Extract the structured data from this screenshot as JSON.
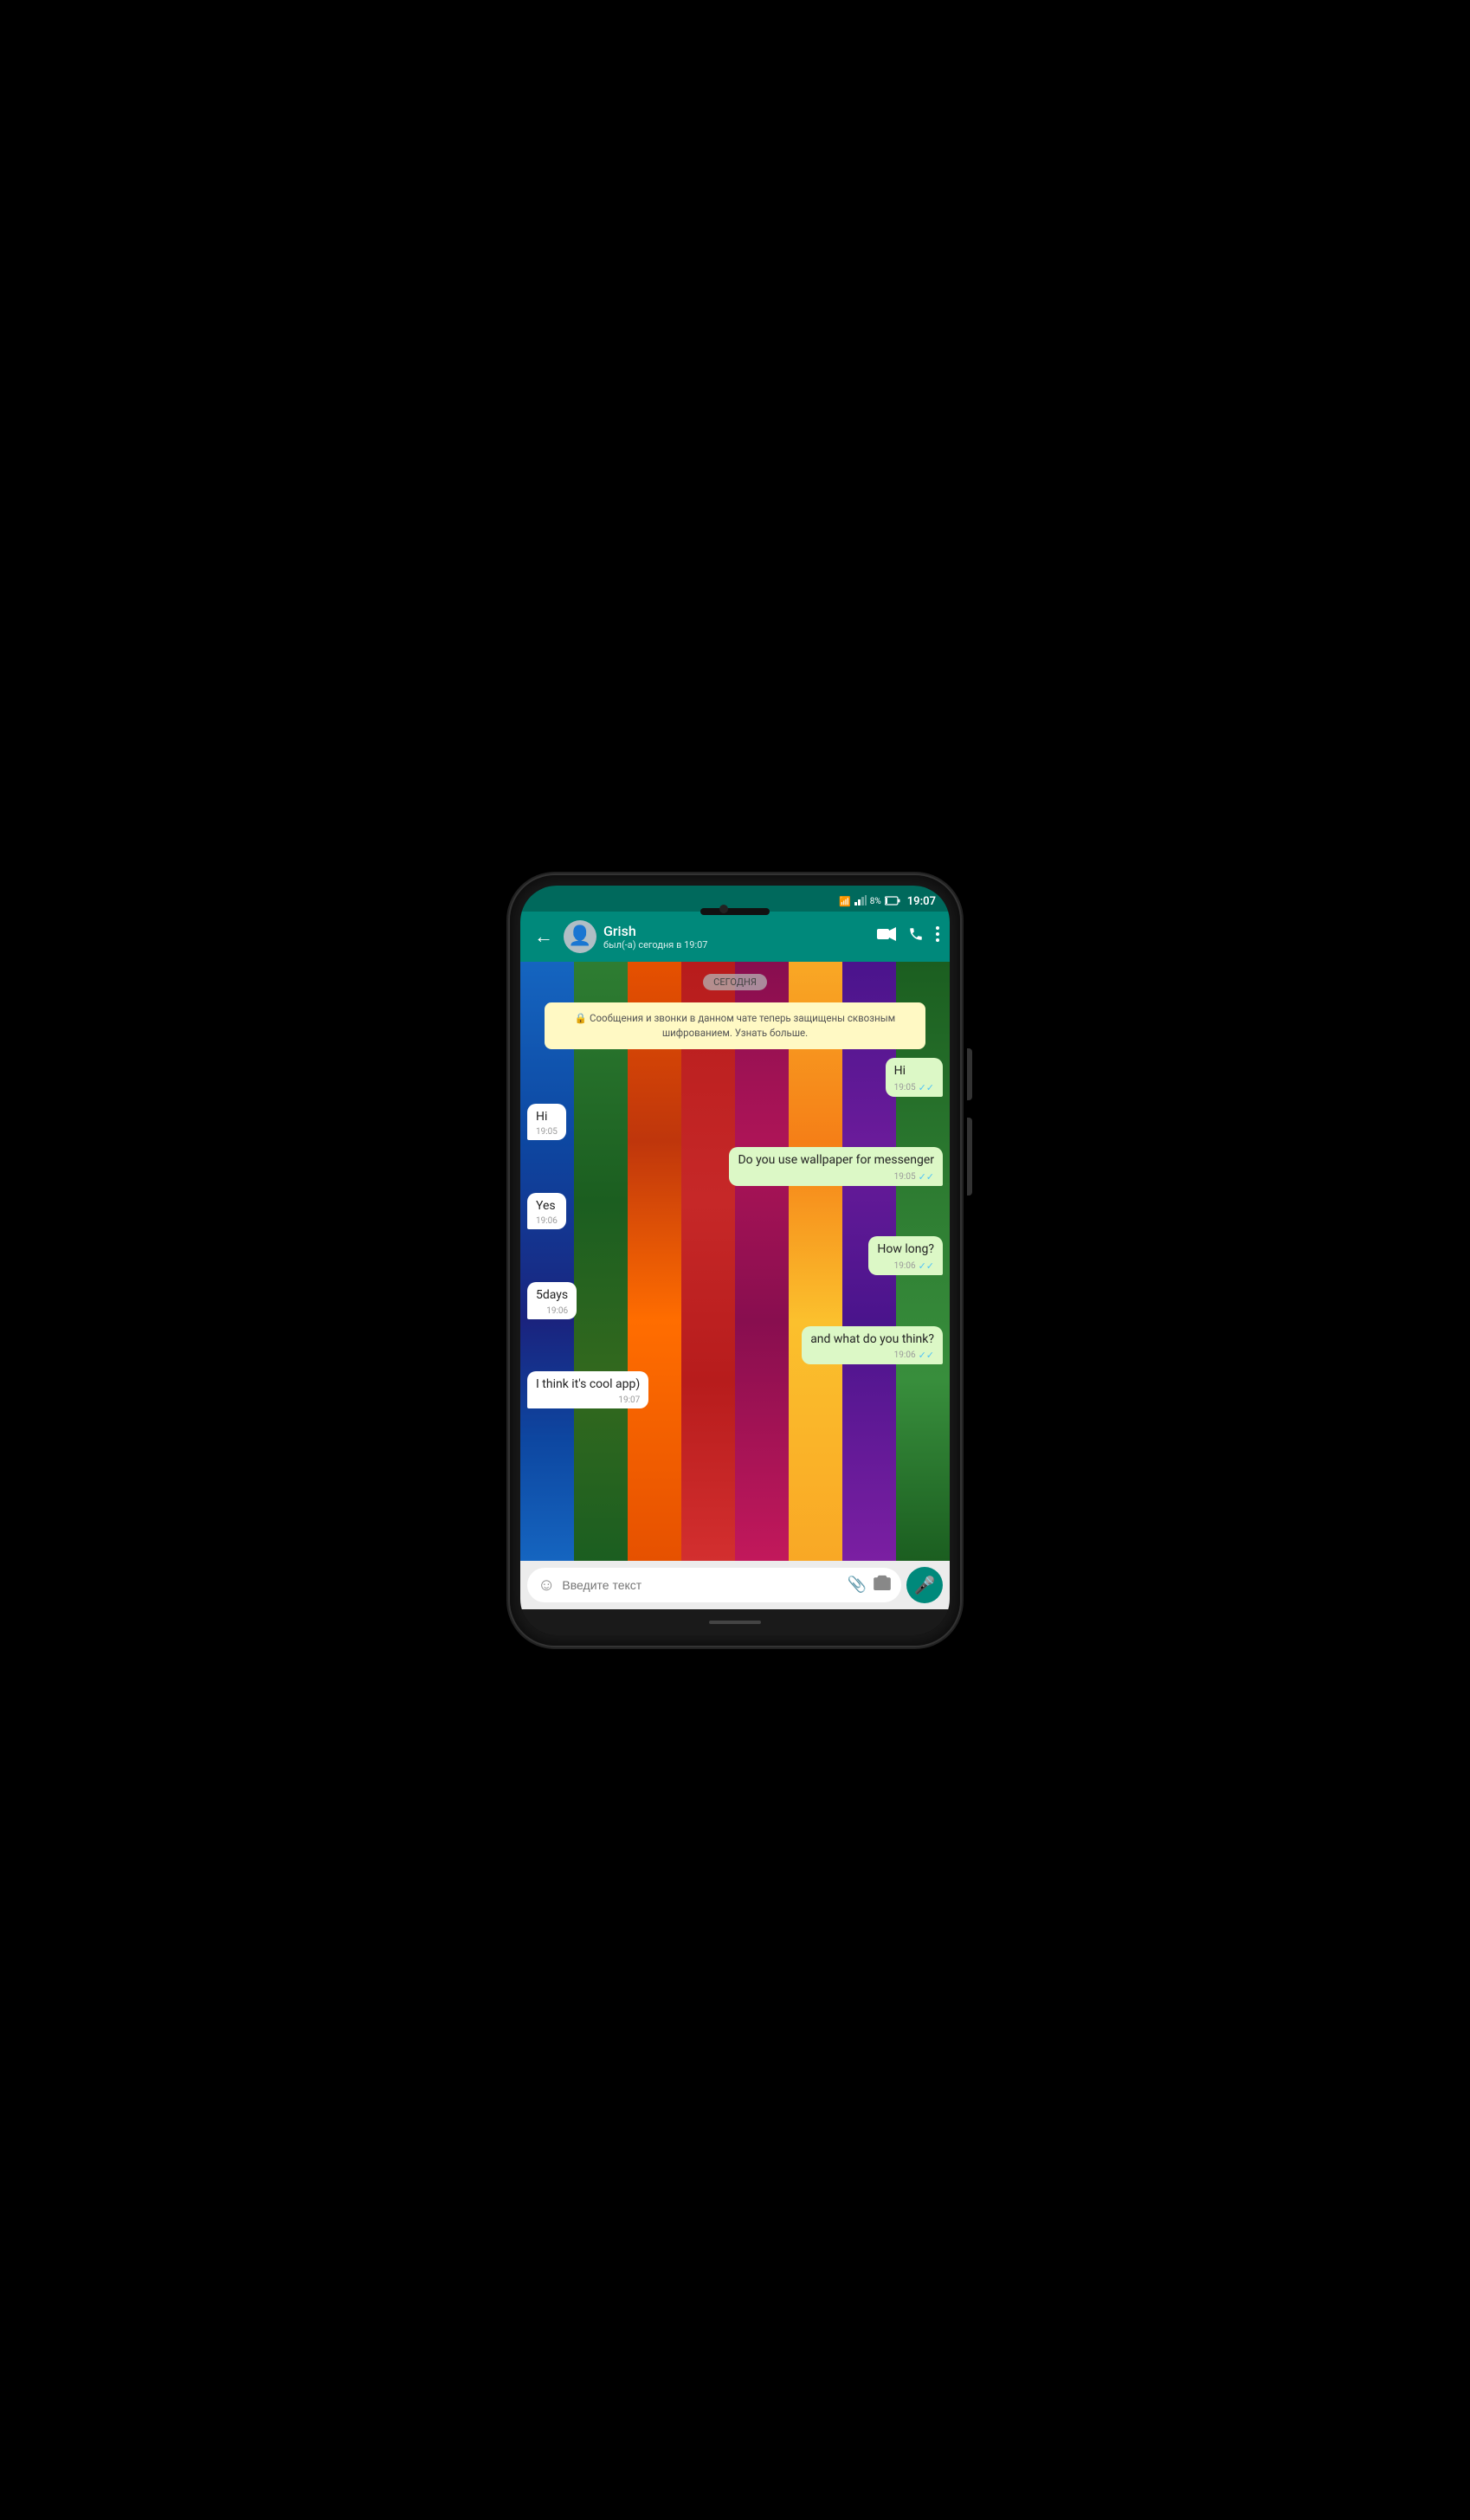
{
  "status_bar": {
    "wifi": "📶",
    "signal": "📶",
    "battery_pct": "8%",
    "time": "19:07"
  },
  "top_bar": {
    "back_label": "←",
    "contact_name": "Grish",
    "contact_status": "был(-а) сегодня в 19:07",
    "video_call_label": "video",
    "phone_call_label": "phone",
    "more_label": "more"
  },
  "chat": {
    "date_badge": "СЕГОДНЯ",
    "encryption_notice": "🔒 Сообщения и звонки в данном чате теперь защищены сквозным шифрованием. Узнать больше.",
    "messages": [
      {
        "id": 1,
        "type": "sent",
        "text": "Hi",
        "time": "19:05",
        "ticks": "✓✓",
        "tick_color": "blue"
      },
      {
        "id": 2,
        "type": "received",
        "text": "Hi",
        "time": "19:05"
      },
      {
        "id": 3,
        "type": "sent",
        "text": "Do you use wallpaper for messenger",
        "time": "19:05",
        "ticks": "✓✓",
        "tick_color": "blue"
      },
      {
        "id": 4,
        "type": "received",
        "text": "Yes",
        "time": "19:06"
      },
      {
        "id": 5,
        "type": "sent",
        "text": "How long?",
        "time": "19:06",
        "ticks": "✓✓",
        "tick_color": "blue"
      },
      {
        "id": 6,
        "type": "received",
        "text": "5days",
        "time": "19:06"
      },
      {
        "id": 7,
        "type": "sent",
        "text": "and what do you think?",
        "time": "19:06",
        "ticks": "✓✓",
        "tick_color": "blue"
      },
      {
        "id": 8,
        "type": "received",
        "text": "I think it's cool app)",
        "time": "19:07"
      }
    ]
  },
  "input_bar": {
    "placeholder": "Введите текст",
    "emoji_icon": "☺",
    "attach_icon": "📎",
    "camera_icon": "📷",
    "mic_icon": "🎤"
  }
}
